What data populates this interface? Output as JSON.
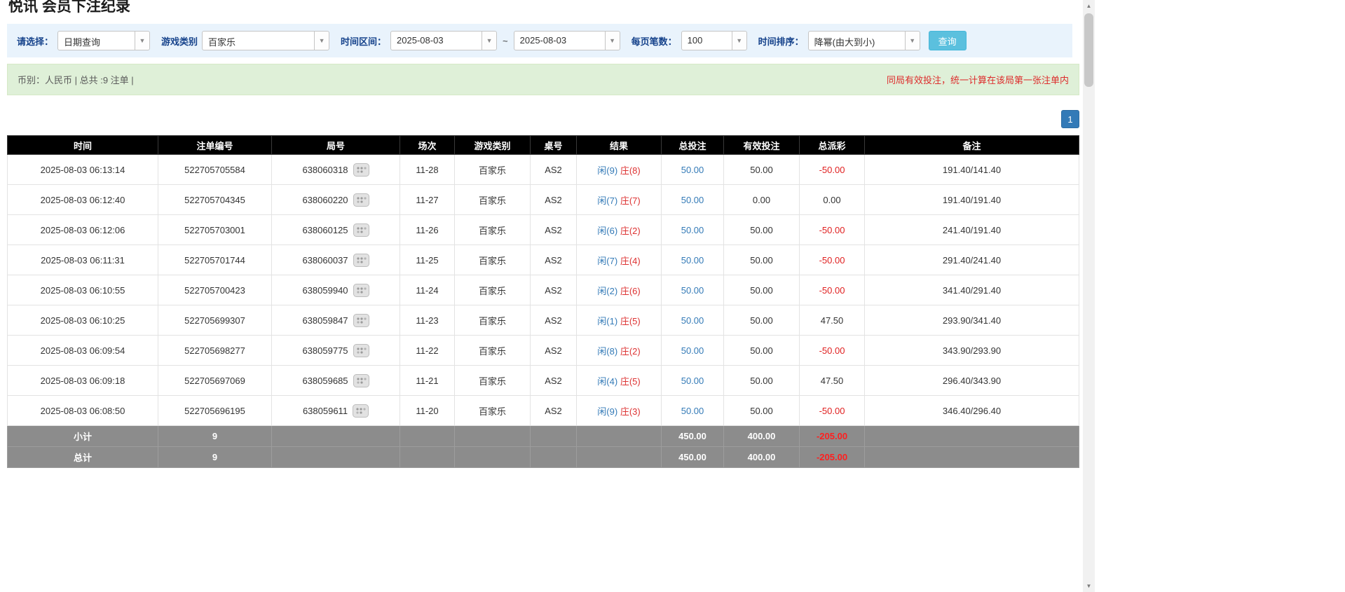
{
  "page": {
    "title": "悦讯 会员下注纪录"
  },
  "filters": {
    "select_label": "请选择：",
    "select_value": "日期查询",
    "game_type_label": "游戏类别",
    "game_type_value": "百家乐",
    "time_range_label": "时间区间：",
    "date_from": "2025-08-03",
    "tilde": "~",
    "date_to": "2025-08-03",
    "page_size_label": "每页笔数：",
    "page_size_value": "100",
    "sort_label": "时间排序：",
    "sort_value": "降幂(由大到小)",
    "search_button": "查询"
  },
  "summary": {
    "left": "币别：人民币 | 总共 :9 注单 |",
    "right": "同局有效投注，统一计算在该局第一张注单内"
  },
  "pagination": {
    "current": "1"
  },
  "table": {
    "headers": [
      "时间",
      "注单编号",
      "局号",
      "场次",
      "游戏类别",
      "桌号",
      "结果",
      "总投注",
      "有效投注",
      "总派彩",
      "备注"
    ],
    "rows": [
      {
        "time": "2025-08-03 06:13:14",
        "bet_id": "522705705584",
        "round_id": "638060318",
        "session": "11-28",
        "game": "百家乐",
        "table_no": "AS2",
        "result_player": "闲(9)",
        "result_banker": "庄(8)",
        "total_bet": "50.00",
        "valid_bet": "50.00",
        "payout": "-50.00",
        "remark": "191.40/141.40"
      },
      {
        "time": "2025-08-03 06:12:40",
        "bet_id": "522705704345",
        "round_id": "638060220",
        "session": "11-27",
        "game": "百家乐",
        "table_no": "AS2",
        "result_player": "闲(7)",
        "result_banker": "庄(7)",
        "total_bet": "50.00",
        "valid_bet": "0.00",
        "payout": "0.00",
        "remark": "191.40/191.40"
      },
      {
        "time": "2025-08-03 06:12:06",
        "bet_id": "522705703001",
        "round_id": "638060125",
        "session": "11-26",
        "game": "百家乐",
        "table_no": "AS2",
        "result_player": "闲(6)",
        "result_banker": "庄(2)",
        "total_bet": "50.00",
        "valid_bet": "50.00",
        "payout": "-50.00",
        "remark": "241.40/191.40"
      },
      {
        "time": "2025-08-03 06:11:31",
        "bet_id": "522705701744",
        "round_id": "638060037",
        "session": "11-25",
        "game": "百家乐",
        "table_no": "AS2",
        "result_player": "闲(7)",
        "result_banker": "庄(4)",
        "total_bet": "50.00",
        "valid_bet": "50.00",
        "payout": "-50.00",
        "remark": "291.40/241.40"
      },
      {
        "time": "2025-08-03 06:10:55",
        "bet_id": "522705700423",
        "round_id": "638059940",
        "session": "11-24",
        "game": "百家乐",
        "table_no": "AS2",
        "result_player": "闲(2)",
        "result_banker": "庄(6)",
        "total_bet": "50.00",
        "valid_bet": "50.00",
        "payout": "-50.00",
        "remark": "341.40/291.40"
      },
      {
        "time": "2025-08-03 06:10:25",
        "bet_id": "522705699307",
        "round_id": "638059847",
        "session": "11-23",
        "game": "百家乐",
        "table_no": "AS2",
        "result_player": "闲(1)",
        "result_banker": "庄(5)",
        "total_bet": "50.00",
        "valid_bet": "50.00",
        "payout": "47.50",
        "remark": "293.90/341.40"
      },
      {
        "time": "2025-08-03 06:09:54",
        "bet_id": "522705698277",
        "round_id": "638059775",
        "session": "11-22",
        "game": "百家乐",
        "table_no": "AS2",
        "result_player": "闲(8)",
        "result_banker": "庄(2)",
        "total_bet": "50.00",
        "valid_bet": "50.00",
        "payout": "-50.00",
        "remark": "343.90/293.90"
      },
      {
        "time": "2025-08-03 06:09:18",
        "bet_id": "522705697069",
        "round_id": "638059685",
        "session": "11-21",
        "game": "百家乐",
        "table_no": "AS2",
        "result_player": "闲(4)",
        "result_banker": "庄(5)",
        "total_bet": "50.00",
        "valid_bet": "50.00",
        "payout": "47.50",
        "remark": "296.40/343.90"
      },
      {
        "time": "2025-08-03 06:08:50",
        "bet_id": "522705696195",
        "round_id": "638059611",
        "session": "11-20",
        "game": "百家乐",
        "table_no": "AS2",
        "result_player": "闲(9)",
        "result_banker": "庄(3)",
        "total_bet": "50.00",
        "valid_bet": "50.00",
        "payout": "-50.00",
        "remark": "346.40/296.40"
      }
    ],
    "subtotal": {
      "label": "小计",
      "count": "9",
      "total_bet": "450.00",
      "valid_bet": "400.00",
      "payout": "-205.00"
    },
    "total": {
      "label": "总计",
      "count": "9",
      "total_bet": "450.00",
      "valid_bet": "400.00",
      "payout": "-205.00"
    }
  },
  "colors": {
    "header_bg": "#000000",
    "footer_bg": "#8c8c8c",
    "filter_bg": "#e9f3fc",
    "summary_bg": "#dff0d8",
    "button_bg": "#5bc0de",
    "link_blue": "#337ab7",
    "banker_red": "#dd3333",
    "negative_red": "#e02020",
    "pagination_blue": "#337ab7"
  }
}
